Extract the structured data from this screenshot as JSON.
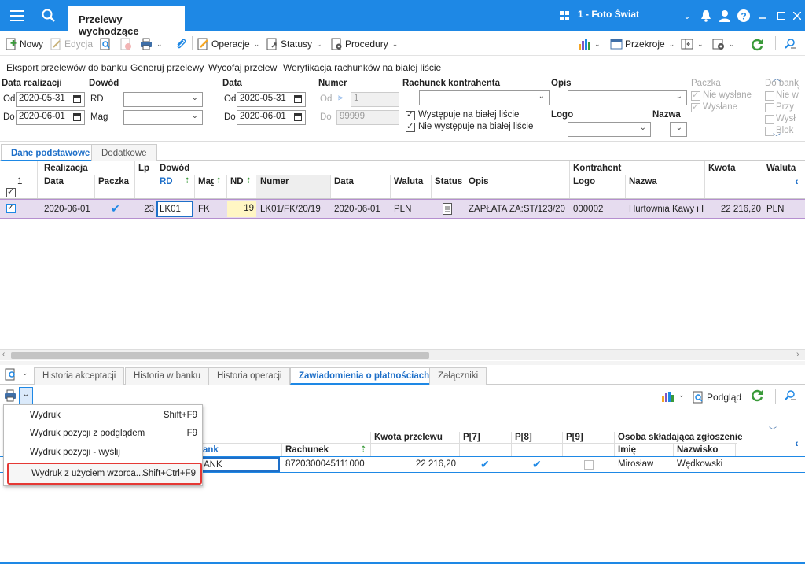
{
  "window": {
    "tab_title": "Przelewy wychodzące",
    "company": "1 - Foto Świat"
  },
  "toolbar": {
    "new": "Nowy",
    "edit": "Edycja",
    "operations": "Operacje",
    "statuses": "Statusy",
    "procedures": "Procedury",
    "cross_sections": "Przekroje"
  },
  "actions": [
    "Eksport przelewów do banku",
    "Generuj przelewy",
    "Wycofaj przelew",
    "Weryfikacja rachunków na białej liście"
  ],
  "filters": {
    "date_realization_label": "Data realizacji",
    "from_label": "Od",
    "to_label": "Do",
    "date_from": "2020-05-31",
    "date_to": "2020-06-01",
    "document_label": "Dowód",
    "rd_label": "RD",
    "mag_label": "Mag",
    "date_label": "Data",
    "date2_from": "2020-05-31",
    "date2_to": "2020-06-01",
    "number_label": "Numer",
    "number_from_label": "Od",
    "number_to_label": "Do",
    "number_from": "1",
    "number_to": "99999",
    "account_label": "Rachunek kontrahenta",
    "whitelist_yes": "Występuje na białej liście",
    "whitelist_no": "Nie występuje na białej liście",
    "description_label": "Opis",
    "logo_label": "Logo",
    "name_label": "Nazwa",
    "package_label": "Paczka",
    "not_sent": "Nie wysłane",
    "sent": "Wysłane",
    "to_bank_label": "Do bank",
    "to_bank_opts": [
      "Nie w",
      "Przy",
      "Wysł",
      "Blok"
    ]
  },
  "tabs": [
    "Dane podstawowe",
    "Dodatkowe"
  ],
  "grid": {
    "group_headers": {
      "realization": "Realizacja",
      "lp": "Lp",
      "document": "Dowód",
      "contractor": "Kontrahent",
      "amount": "Kwota",
      "currency": "Waluta"
    },
    "count": "1",
    "columns": {
      "date": "Data",
      "package": "Paczka",
      "rd": "RD",
      "mag": "Mag",
      "nd": "ND",
      "number": "Numer",
      "doc_date": "Data",
      "currency": "Waluta",
      "status": "Status",
      "description": "Opis",
      "logo": "Logo",
      "name": "Nazwa"
    },
    "row": {
      "date": "2020-06-01",
      "lp": "23",
      "rd": "LK01",
      "mag": "FK",
      "nd": "19",
      "number": "LK01/FK/20/19",
      "doc_date": "2020-06-01",
      "currency": "PLN",
      "description": "ZAPŁATA ZA:ST/123/20",
      "logo": "000002",
      "name": "Hurtownia Kawy i I",
      "amount": "22 216,20",
      "currency2": "PLN"
    }
  },
  "bottom_tabs": [
    "Historia akceptacji",
    "Historia w banku",
    "Historia operacji",
    "Zawiadomienia o płatnościach",
    "Załączniki"
  ],
  "bottom_toolbar": {
    "preview": "Podgląd"
  },
  "bottom_grid": {
    "headers": {
      "amount": "Kwota przelewu",
      "p7": "P[7]",
      "p8": "P[8]",
      "p9": "P[9]",
      "person": "Osoba składająca zgłoszenie",
      "bank": "ank",
      "account": "Rachunek",
      "first_name": "Imię",
      "last_name": "Nazwisko"
    },
    "row": {
      "bank": "ANK",
      "account": "8720300045111000",
      "amount": "22 216,20",
      "first_name": "Mirosław",
      "last_name": "Wędkowski"
    }
  },
  "menu": [
    {
      "label": "Wydruk",
      "shortcut": "Shift+F9"
    },
    {
      "label": "Wydruk pozycji z podglądem",
      "shortcut": "F9"
    },
    {
      "label": "Wydruk pozycji - wyślij",
      "shortcut": ""
    },
    {
      "label": "Wydruk z użyciem wzorca...",
      "shortcut": "Shift+Ctrl+F9"
    }
  ]
}
